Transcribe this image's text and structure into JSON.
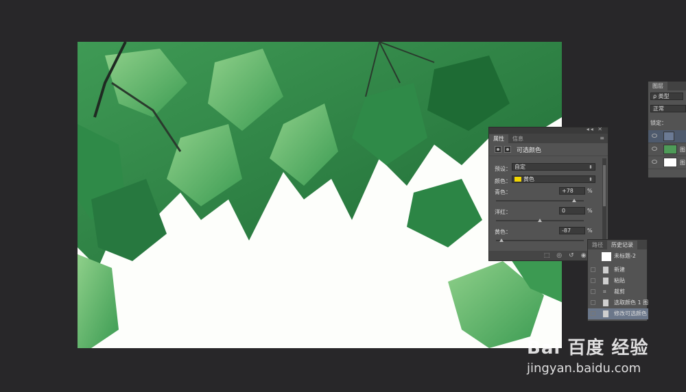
{
  "properties_panel": {
    "tabs": [
      "属性",
      "信息"
    ],
    "title": "可选颜色",
    "preset_label": "预设：",
    "preset_value": "自定",
    "color_label": "颜色：",
    "color_value": "黄色",
    "color_swatch": "#f2d600",
    "sliders": [
      {
        "label": "青色：",
        "value": "+78",
        "unit": "%",
        "level": 0.89
      },
      {
        "label": "洋红：",
        "value": "0",
        "unit": "%",
        "level": 0.5
      },
      {
        "label": "黄色：",
        "value": "-87",
        "unit": "%",
        "level": 0.065
      }
    ],
    "bottom_icons": [
      "clip-to-layer-icon",
      "visibility-icon",
      "reset-icon",
      "eye-icon",
      "trash-icon"
    ]
  },
  "layers_panel": {
    "tab": "图层",
    "filter_value": "ρ 类型",
    "blend_mode": "正常",
    "lock_label": "锁定：",
    "layers": [
      {
        "name": "",
        "type": "adjustment",
        "selected": true
      },
      {
        "name": "图",
        "type": "image",
        "selected": false
      },
      {
        "name": "图",
        "type": "white",
        "selected": false
      }
    ]
  },
  "history_panel": {
    "tabs": [
      "路径",
      "历史记录"
    ],
    "snapshot": "未标题-2",
    "items": [
      "新建",
      "粘贴",
      "裁剪",
      "选取颜色 1 图",
      "修改可选颜色"
    ]
  },
  "watermark": {
    "logo": "Bai 百度 经验",
    "url": "jingyan.baidu.com"
  }
}
